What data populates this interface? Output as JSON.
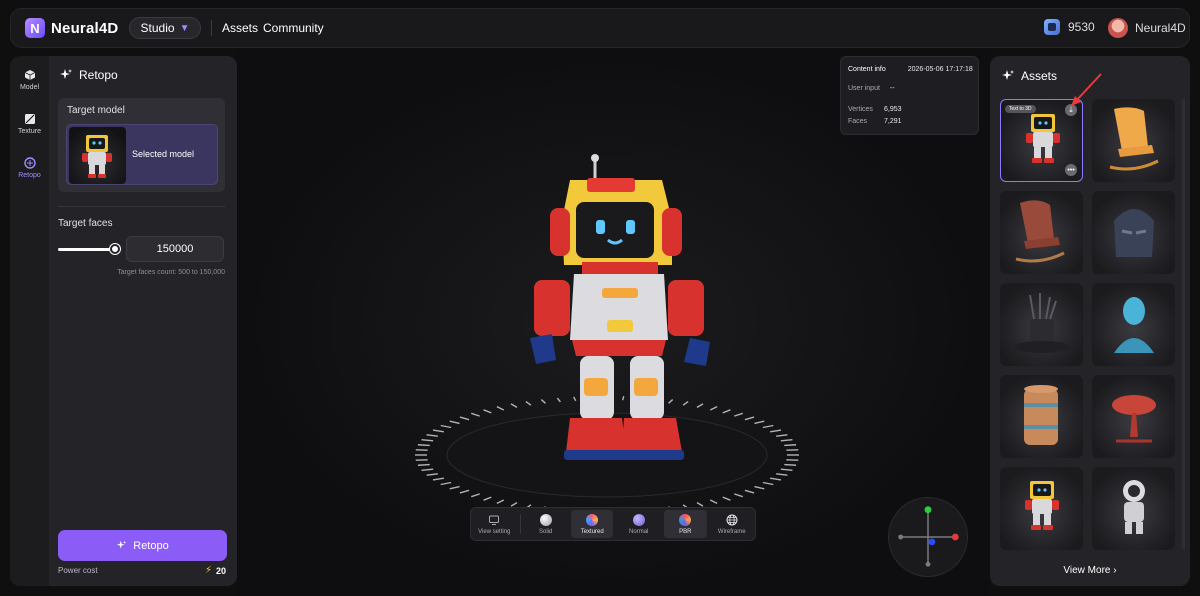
{
  "brand": {
    "name": "Neural4D",
    "logo_letter": "N"
  },
  "topbar": {
    "studio_label": "Studio",
    "nav": [
      "Assets",
      "Community"
    ],
    "credits": "9530",
    "username": "Neural4D"
  },
  "rail": [
    {
      "label": "Model",
      "icon": "cube-icon",
      "active": false
    },
    {
      "label": "Texture",
      "icon": "texture-icon",
      "active": false
    },
    {
      "label": "Retopo",
      "icon": "retopo-icon",
      "active": true
    }
  ],
  "left_panel": {
    "title": "Retopo",
    "target_model_label": "Target model",
    "selected_model_label": "Selected model",
    "target_faces_label": "Target faces",
    "target_faces_value": "150000",
    "slider_level": 1.0,
    "target_faces_hint": "Target faces count: 500 to 150,000",
    "retopo_button": "Retopo",
    "power_cost_label": "Power cost",
    "power_cost_value": "20"
  },
  "content_info": {
    "title": "Content info",
    "datetime": "2026-05-06 17:17:18",
    "user_input_label": "User input",
    "user_input_value": "--",
    "vertices_label": "Vertices",
    "vertices_value": "6,953",
    "faces_label": "Faces",
    "faces_value": "7,291"
  },
  "view_bar": [
    {
      "label": "View setting",
      "icon": "view-setting-icon",
      "active": false
    },
    {
      "label": "Solid",
      "icon": "solid-ball-icon",
      "active": false
    },
    {
      "label": "Textured",
      "icon": "textured-ball-icon",
      "active": true
    },
    {
      "label": "Normal",
      "icon": "normal-ball-icon",
      "active": false
    },
    {
      "label": "PBR",
      "icon": "pbr-ball-icon",
      "active": true
    },
    {
      "label": "Wireframe",
      "icon": "wireframe-globe-icon",
      "active": false
    }
  ],
  "assets_panel": {
    "title": "Assets",
    "first_tile_badge": "Text to 3D",
    "tiles": [
      "robot",
      "rocking-chair-yellow",
      "rocking-chair-brown",
      "helmet",
      "pen-holder",
      "cyborg-bust",
      "barrel",
      "mushroom",
      "robot",
      "astronaut"
    ],
    "view_more": "View More"
  },
  "colors": {
    "accent": "#8b5cf6",
    "panel": "#242428",
    "background": "#0f0f10"
  }
}
